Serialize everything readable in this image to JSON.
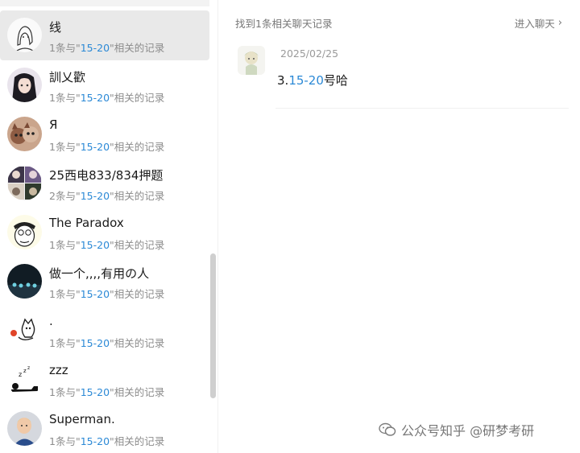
{
  "results": [
    {
      "name": "线",
      "count": "1",
      "avatar": "sketch-avatar-icon",
      "selected": true
    },
    {
      "name": "訓乂歡",
      "count": "1",
      "avatar": "anime-girl-avatar-icon"
    },
    {
      "name": "Я",
      "count": "1",
      "avatar": "cats-avatar-icon"
    },
    {
      "name": "25西电833/834押题",
      "count": "2",
      "avatar": "group-avatar-icon"
    },
    {
      "name": "The Paradox",
      "count": "1",
      "avatar": "cartoon-face-avatar-icon"
    },
    {
      "name": "做一个,,,,有用の人",
      "count": "1",
      "avatar": "dark-scene-avatar-icon"
    },
    {
      "name": ".",
      "count": "1",
      "avatar": "cat-drawing-avatar-icon"
    },
    {
      "name": "zzz",
      "count": "1",
      "avatar": "sleeping-avatar-icon"
    },
    {
      "name": "Superman.",
      "count": "1",
      "avatar": "baby-photo-avatar-icon"
    }
  ],
  "sub_template": {
    "prefix": "条与\"",
    "term": "15-20",
    "suffix": "\"相关的记录"
  },
  "detail": {
    "found_text": "找到1条相关聊天记录",
    "enter_chat": "进入聊天",
    "chevron": "›",
    "message": {
      "date": "2025/02/25",
      "prefix": "3.",
      "term": "15-20",
      "suffix": "号哈"
    }
  },
  "watermark": "公众号知乎 @研梦考研",
  "colors": {
    "highlight": "#2b89d6",
    "selected_bg": "#e9e9e9"
  }
}
